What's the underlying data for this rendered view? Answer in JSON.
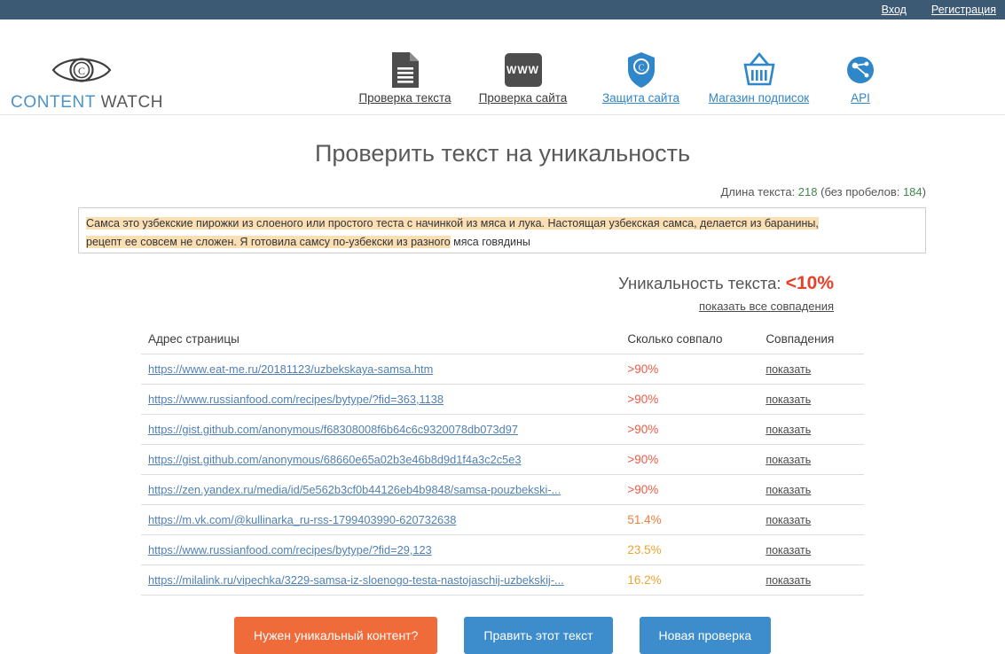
{
  "topbar": {
    "login": "Вход",
    "register": "Регистрация"
  },
  "brand": {
    "name_part1": "CONTENT",
    "name_part2": " WATCH",
    "icon": "eye-copyright-icon"
  },
  "nav": {
    "items": [
      {
        "label": "Проверка текста",
        "icon": "document-text-icon",
        "style": "dark"
      },
      {
        "label": "Проверка сайта",
        "icon": "www-box-icon",
        "style": "dark"
      },
      {
        "label": "Защита сайта",
        "icon": "shield-copyright-icon",
        "style": "blue"
      },
      {
        "label": "Магазин подписок",
        "icon": "basket-icon",
        "style": "blue"
      },
      {
        "label": "API",
        "icon": "api-nodes-icon",
        "style": "blue"
      }
    ]
  },
  "main": {
    "title": "Проверить текст на уникальность",
    "length_prefix": "Длина текста: ",
    "length_value": "218",
    "length_middle": " (без пробелов: ",
    "length_nospaces": "184",
    "length_suffix": ")",
    "text_highlighted_1": "Самса это узбекские пирожки из слоеного или простого теста с начинкой из мяса и лука. Настоящая узбекская самса, делается из баранины,",
    "text_highlighted_2": "рецепт ее совсем не сложен. Я готовила самсу по-узбекски из разного",
    "text_plain_tail": " мяса говядины",
    "uniqueness_label": "Уникальность текста: ",
    "uniqueness_value": "<10%",
    "show_all_label": "показать все совпадения"
  },
  "table": {
    "headers": {
      "url": "Адрес страницы",
      "percent": "Сколько совпало",
      "matches": "Совпадения"
    },
    "rows": [
      {
        "url": "https://www.eat-me.ru/20181123/uzbekskaya-samsa.htm",
        "percent": ">90%",
        "level": "high",
        "match": "показать"
      },
      {
        "url": "https://www.russianfood.com/recipes/bytype/?fid=363,1138",
        "percent": ">90%",
        "level": "high",
        "match": "показать"
      },
      {
        "url": "https://gist.github.com/anonymous/f68308008f6b64c6c9320078db073d97",
        "percent": ">90%",
        "level": "high",
        "match": "показать"
      },
      {
        "url": "https://gist.github.com/anonymous/68660e65a02b3e46b8d9d1f4a3c2c5e3",
        "percent": ">90%",
        "level": "high",
        "match": "показать"
      },
      {
        "url": "https://zen.yandex.ru/media/id/5e562b3cf0b44126eb4b9848/samsa-pouzbekski-...",
        "percent": ">90%",
        "level": "high",
        "match": "показать"
      },
      {
        "url": "https://m.vk.com/@kullinarka_ru-rss-1799403990-620732638",
        "percent": "51.4%",
        "level": "mid",
        "match": "показать"
      },
      {
        "url": "https://www.russianfood.com/recipes/bytype/?fid=29,123",
        "percent": "23.5%",
        "level": "low",
        "match": "показать"
      },
      {
        "url": "https://milalink.ru/vipechka/3229-samsa-iz-sloenogo-testa-nastojaschij-uzbekskij-...",
        "percent": "16.2%",
        "level": "low",
        "match": "показать"
      }
    ]
  },
  "buttons": [
    {
      "label": "Нужен уникальный контент?",
      "style": "orange",
      "name": "need-unique-content-button"
    },
    {
      "label": "Править этот текст",
      "style": "blue",
      "name": "edit-text-button"
    },
    {
      "label": "Новая проверка",
      "style": "blue",
      "name": "new-check-button"
    }
  ],
  "colors": {
    "topbar": "#3d5a75",
    "accent_blue": "#3d8dcc",
    "accent_orange": "#ef6c3a",
    "danger_red": "#e8402a",
    "highlight": "#fbdfb4",
    "green": "#3f8a4f"
  }
}
